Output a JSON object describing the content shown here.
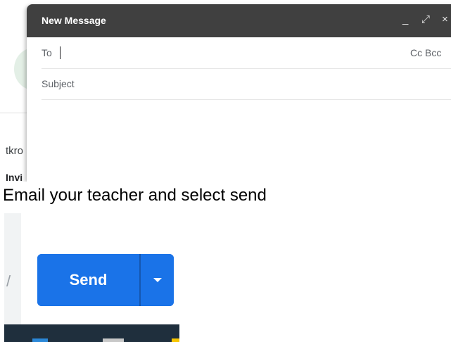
{
  "compose": {
    "title": "New Message",
    "controls": {
      "minimize": "_",
      "expand": "⤢",
      "close": "×"
    },
    "to_label": "To",
    "cc_bcc": "Cc Bcc",
    "subject_placeholder": "Subject"
  },
  "inbox_peek": {
    "sender_fragment": "tkro",
    "subject_fragment": "Invi"
  },
  "caption": "Email your teacher and select send",
  "send": {
    "label": "Send",
    "more_options_icon": "caret-down-icon"
  },
  "colors": {
    "compose_header": "#404040",
    "send_button": "#1a73e8",
    "taskbar": "#1f2f3d"
  }
}
